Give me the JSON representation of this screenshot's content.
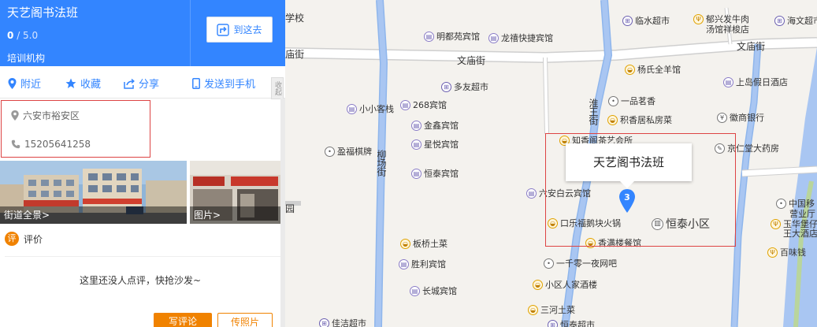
{
  "place": {
    "name": "天艺阁书法班",
    "rating_value": "0",
    "rating_max": "/ 5.0",
    "category": "培训机构",
    "route_label": "到这去"
  },
  "actions": {
    "nearby": "附近",
    "favorite": "收藏",
    "share": "分享",
    "send_to_phone": "发送到手机",
    "collapse": "收起"
  },
  "info": {
    "address": "六安市裕安区",
    "phone": "15205641258"
  },
  "photos": {
    "street_view_label": "街道全景>",
    "photos_label": "图片>"
  },
  "review": {
    "badge": "评",
    "title": "评价",
    "empty_text": "这里还没人点评，快抢沙发~",
    "write_button": "写评论",
    "upload_button": "传照片"
  },
  "map": {
    "colors": {
      "river": "#a9c6f2",
      "road": "#ffffff",
      "road_border": "#cfcfcf",
      "pin": "#3385ff",
      "highlight": "#dd4444"
    },
    "marker_number": "3",
    "callout_title": "天艺阁书法班",
    "estate_label": "恒泰小区",
    "estate_icon": "building-icon",
    "streets": {
      "school_fragment": "学校",
      "miao_fragment": "庙街",
      "wenmiao_1": "文庙街",
      "wenmiao_2": "文庙街",
      "huaiwang": "淮王街",
      "liuchang": "柳场街",
      "fang_fragment": "园"
    },
    "pois": [
      {
        "name": "明都苑宾馆",
        "icon": "hotel"
      },
      {
        "name": "龙禧快捷宾馆",
        "icon": "hotel"
      },
      {
        "name": "临水超市",
        "icon": "shop"
      },
      {
        "name": "郁兴发牛肉",
        "icon": "food"
      },
      {
        "name": "汤馆祥梭店",
        "icon": "none"
      },
      {
        "name": "海文超市",
        "icon": "shop"
      },
      {
        "name": "杨氏全羊馆",
        "icon": "food"
      },
      {
        "name": "上岛假日酒店",
        "icon": "hotel"
      },
      {
        "name": "多友超市",
        "icon": "shop"
      },
      {
        "name": "小小客栈",
        "icon": "hotel"
      },
      {
        "name": "268宾馆",
        "icon": "hotel"
      },
      {
        "name": "一品茗香",
        "icon": "place"
      },
      {
        "name": "积香居私房菜",
        "icon": "food"
      },
      {
        "name": "徽商银行",
        "icon": "bank"
      },
      {
        "name": "金鑫宾馆",
        "icon": "hotel"
      },
      {
        "name": "星悦宾馆",
        "icon": "hotel"
      },
      {
        "name": "知香阁茶艺会所",
        "icon": "food"
      },
      {
        "name": "京仁堂大药房",
        "icon": "pharm"
      },
      {
        "name": "盈福棋牌",
        "icon": "place"
      },
      {
        "name": "恒泰宾馆",
        "icon": "hotel"
      },
      {
        "name": "六安白云宾馆",
        "icon": "hotel"
      },
      {
        "name": "中国移",
        "icon": "place"
      },
      {
        "name": "营业厅",
        "icon": "none"
      },
      {
        "name": "口乐福鹅块火锅",
        "icon": "food"
      },
      {
        "name": "玉华堡仔",
        "icon": "food"
      },
      {
        "name": "王大酒店",
        "icon": "none"
      },
      {
        "name": "板桥土菜",
        "icon": "food"
      },
      {
        "name": "香满楼餐馆",
        "icon": "food"
      },
      {
        "name": "百味钱",
        "icon": "food"
      },
      {
        "name": "胜利宾馆",
        "icon": "hotel"
      },
      {
        "name": "一千零一夜网吧",
        "icon": "place"
      },
      {
        "name": "小区人家酒楼",
        "icon": "food"
      },
      {
        "name": "长城宾馆",
        "icon": "hotel"
      },
      {
        "name": "三河土菜",
        "icon": "food"
      },
      {
        "name": "佳洁超市",
        "icon": "shop"
      },
      {
        "name": "恒泰超市",
        "icon": "shop"
      }
    ]
  }
}
